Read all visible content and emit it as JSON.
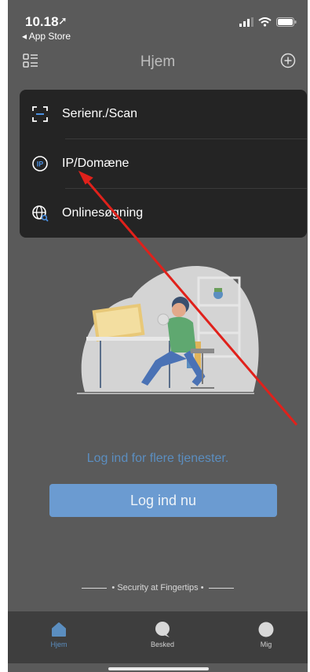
{
  "status_bar": {
    "time": "10.18",
    "back_app": "◂ App Store"
  },
  "header": {
    "title": "Hjem",
    "left_icon": "list-icon",
    "right_icon": "plus-circle-icon"
  },
  "menu": {
    "items": [
      {
        "label": "Serienr./Scan",
        "icon": "scan-icon"
      },
      {
        "label": "IP/Domæne",
        "icon": "ip-icon"
      },
      {
        "label": "Onlinesøgning",
        "icon": "globe-search-icon"
      }
    ]
  },
  "login": {
    "prompt": "Log ind for flere tjenester.",
    "button": "Log ind nu"
  },
  "tagline": "• Security at Fingertips •",
  "tabbar": {
    "tabs": [
      {
        "label": "Hjem",
        "icon": "home-icon",
        "active": true
      },
      {
        "label": "Besked",
        "icon": "message-icon",
        "active": false
      },
      {
        "label": "Mig",
        "icon": "profile-icon",
        "active": false
      }
    ]
  },
  "colors": {
    "accent": "#5b8ec0",
    "button": "#6b9bd1",
    "menu_bg": "#242424",
    "annotation_arrow": "#e0211b"
  }
}
